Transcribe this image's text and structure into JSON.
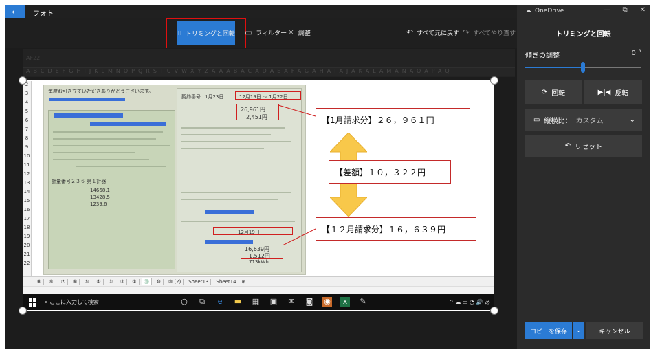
{
  "titlebar": {
    "back_glyph": "←",
    "app_title": "フォト"
  },
  "toolbar": {
    "crop_label": "トリミングと回転",
    "filter_label": "フィルター",
    "adjust_label": "調整",
    "revert_label": "すべて元に戻す",
    "redo_label": "すべてやり直す"
  },
  "background_sheet": {
    "cell_ref": "AF22",
    "columns": [
      "A",
      "B",
      "C",
      "D",
      "E",
      "F",
      "G",
      "H",
      "I",
      "J",
      "K",
      "L",
      "M",
      "N",
      "O",
      "P",
      "Q",
      "R",
      "S",
      "T",
      "U",
      "V",
      "W",
      "X",
      "Y",
      "Z",
      "AA",
      "AB",
      "AC",
      "AD",
      "AE",
      "AF",
      "AG",
      "AH",
      "AI",
      "AJ",
      "AK",
      "AL",
      "AM",
      "AN",
      "AO",
      "AP",
      "AQ"
    ]
  },
  "image": {
    "row_numbers": [
      "2",
      "3",
      "4",
      "5",
      "6",
      "7",
      "8",
      "9",
      "10",
      "11",
      "12",
      "13",
      "14",
      "15",
      "16",
      "17",
      "18",
      "19",
      "20",
      "21",
      "22"
    ],
    "receipt": {
      "top_left": "毎度お引き立ていただきありがとうございます。",
      "contract": "契約番号",
      "period_left": "1月23日",
      "period_text": "12月19日 〜 1月22日",
      "amount_jan": "26,961円",
      "amount_small": "2,451円",
      "meter": "計量番号２３６ 第１計器",
      "reading1": "14668.1",
      "reading2": "13428.5",
      "reading3": "1239.6",
      "dec_label": "12月19日",
      "amount_dec": "16,639円",
      "amount_dec_small": "1,512円",
      "usage_dec": "713kWh"
    },
    "callouts": {
      "january": "【1月請求分】２６，９６１円",
      "difference": "【差額】１０，３２２円",
      "december": "【１２月請求分】１６，６３９円"
    },
    "sheet_tabs": [
      "⑧",
      "⑨",
      "⑦",
      "⑥",
      "⑤",
      "④",
      "③",
      "②",
      "①",
      "⑪",
      "⑩",
      "⑩ (2)",
      "Sheet13",
      "Sheet14"
    ],
    "add_sheet_glyph": "⊕",
    "taskbar": {
      "search_placeholder": "ここに入力して検索",
      "tray_text": "^ ☁ ▭ ◔ 🔊 あ"
    }
  },
  "sidebar": {
    "onedrive_label": "OneDrive",
    "min_glyph": "—",
    "max_glyph": "⧉",
    "close_glyph": "✕",
    "heading": "トリミングと回転",
    "tilt_label": "傾きの調整",
    "tilt_value": "0 °",
    "tilt_level": 0.5,
    "rotate_label": "回転",
    "flip_label": "反転",
    "aspect_label": "縦横比：",
    "aspect_value": "カスタム",
    "reset_label": "リセット",
    "save_label": "コピーを保存",
    "cancel_label": "キャンセル"
  },
  "colors": {
    "accent": "#2b7bd4",
    "highlight_red": "#e01010",
    "arrow_fill": "#f8c84a"
  }
}
